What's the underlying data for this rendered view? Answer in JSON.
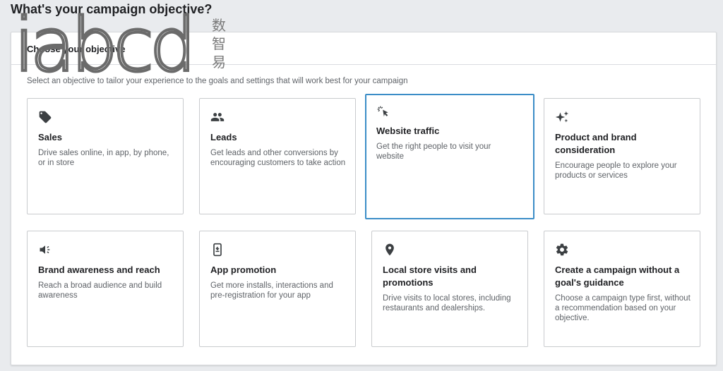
{
  "page": {
    "heading": "What's your campaign objective?"
  },
  "panel": {
    "title": "Choose your objective",
    "subtitle": "Select an objective to tailor your experience to the goals and settings that will work best for your campaign"
  },
  "watermark": {
    "letters": "iabcd",
    "chinese": [
      "数",
      "智",
      "易"
    ]
  },
  "objectives": [
    {
      "title": "Sales",
      "description": "Drive sales online, in app, by phone, or in store",
      "icon": "tag-icon",
      "selected": false
    },
    {
      "title": "Leads",
      "description": "Get leads and other conversions by encouraging customers to take action",
      "icon": "people-icon",
      "selected": false
    },
    {
      "title": "Website traffic",
      "description": "Get the right people to visit your website",
      "icon": "cursor-click-icon",
      "selected": true
    },
    {
      "title": "Product and brand consideration",
      "description": "Encourage people to explore your products or services",
      "icon": "sparkle-icon",
      "selected": false
    },
    {
      "title": "Brand awareness and reach",
      "description": "Reach a broad audience and build awareness",
      "icon": "megaphone-icon",
      "selected": false
    },
    {
      "title": "App promotion",
      "description": "Get more installs, interactions and pre-registration for your app",
      "icon": "phone-icon",
      "selected": false
    },
    {
      "title": "Local store visits and promotions",
      "description": "Drive visits to local stores, including restaurants and dealerships.",
      "icon": "location-pin-icon",
      "selected": false
    },
    {
      "title": "Create a campaign without a goal's guidance",
      "description": "Choose a campaign type first, without a recommendation based on your objective.",
      "icon": "gear-icon",
      "selected": false
    }
  ],
  "colors": {
    "selected_border": "#3b8dc7",
    "card_border": "#c9cbce",
    "background": "#e9ebee"
  }
}
